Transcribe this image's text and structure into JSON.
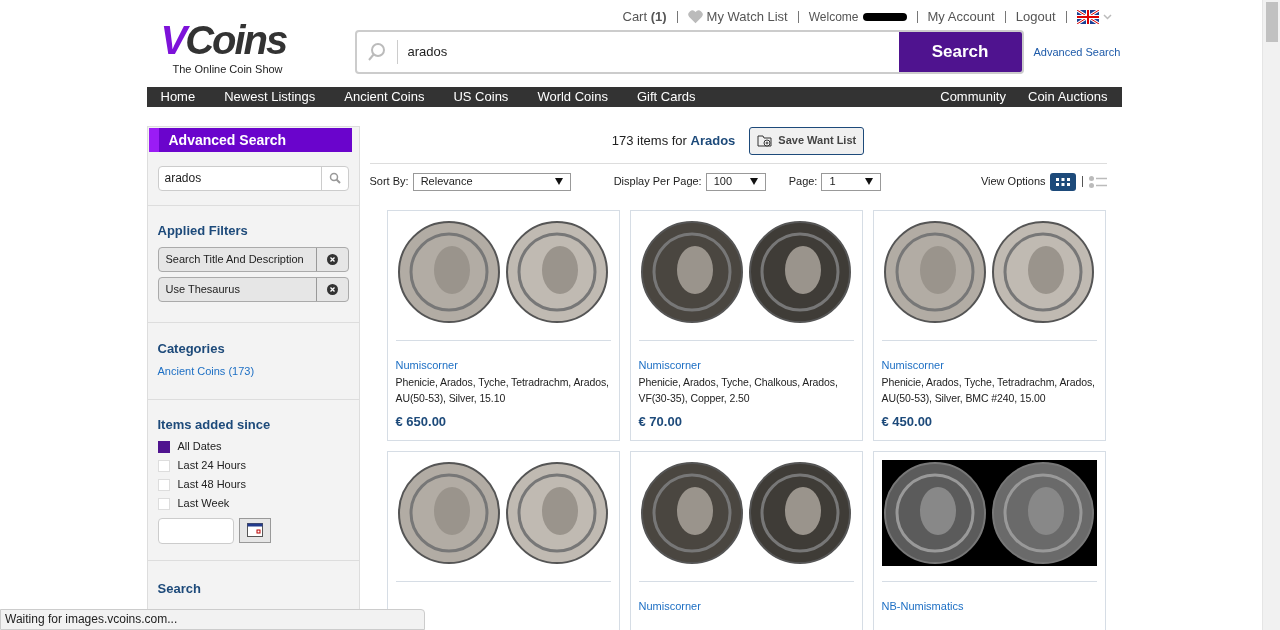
{
  "header": {
    "logo": {
      "mark": "V",
      "word": "Coins",
      "tagline": "The Online Coin Show"
    },
    "top_links": [
      {
        "kind": "cart",
        "label": "Cart",
        "count": "(1)"
      },
      {
        "kind": "watch",
        "label": "My Watch List"
      },
      {
        "kind": "welcome",
        "label": "Welcome"
      },
      {
        "kind": "link",
        "label": "My Account"
      },
      {
        "kind": "link",
        "label": "Logout"
      },
      {
        "kind": "flag"
      }
    ],
    "search": {
      "value": "arados",
      "button": "Search",
      "advanced": "Advanced Search"
    }
  },
  "nav": {
    "left": [
      "Home",
      "Newest Listings",
      "Ancient Coins",
      "US Coins",
      "World Coins",
      "Gift Cards"
    ],
    "right": [
      "Community",
      "Coin Auctions"
    ]
  },
  "sidebar": {
    "title": "Advanced Search",
    "search_value": "arados",
    "applied_filters": {
      "title": "Applied Filters",
      "items": [
        "Search Title And Description",
        "Use Thesaurus"
      ]
    },
    "categories": {
      "title": "Categories",
      "items": [
        "Ancient Coins (173)"
      ]
    },
    "items_added": {
      "title": "Items added since",
      "options": [
        {
          "label": "All Dates",
          "selected": true
        },
        {
          "label": "Last 24 Hours",
          "selected": false
        },
        {
          "label": "Last 48 Hours",
          "selected": false
        },
        {
          "label": "Last Week",
          "selected": false
        }
      ]
    },
    "search_title": "Search"
  },
  "results": {
    "count": "173 items for",
    "query": "Arados",
    "save_button": "Save Want List",
    "sort": {
      "label": "Sort By:",
      "value": "Relevance"
    },
    "per_page": {
      "label": "Display Per Page:",
      "value": "100"
    },
    "page": {
      "label": "Page:",
      "value": "1"
    },
    "view_options": {
      "label": "View Options",
      "grid_selected": true
    },
    "cards": [
      {
        "seller": "Numiscorner",
        "title": "Phenicie, Arados, Tyche, Tetradrachm, Arados, AU(50-53), Silver, 15.10",
        "price": "€ 650.00",
        "dark_background": false
      },
      {
        "seller": "Numiscorner",
        "title": "Phenicie, Arados, Tyche, Chalkous, Arados, VF(30-35), Copper, 2.50",
        "price": "€ 70.00",
        "dark_background": false
      },
      {
        "seller": "Numiscorner",
        "title": "Phenicie, Arados, Tyche, Tetradrachm, Arados, AU(50-53), Silver, BMC #240, 15.00",
        "price": "€ 450.00",
        "dark_background": false
      },
      {
        "dark_background": false
      },
      {
        "seller": "Numiscorner",
        "dark_background": false
      },
      {
        "seller": "NB-Numismatics",
        "dark_background": true
      }
    ]
  },
  "status_bar": "Waiting for images.vcoins.com..."
}
